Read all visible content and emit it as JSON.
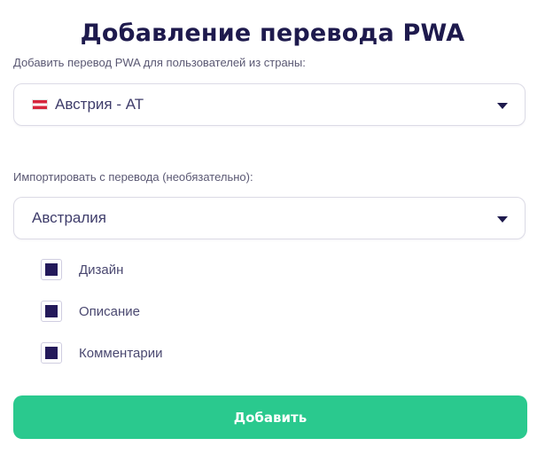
{
  "title": "Добавление перевода PWA",
  "country_field": {
    "label": "Добавить перевод PWA для пользователей из страны:",
    "selected": "Австрия - AT",
    "flag_icon": "flag-austria-icon"
  },
  "import_field": {
    "label": "Импортировать с перевода (необязательно):",
    "selected": "Австралия"
  },
  "options": [
    {
      "label": "Дизайн",
      "checked": true
    },
    {
      "label": "Описание",
      "checked": true
    },
    {
      "label": "Комментарии",
      "checked": true
    }
  ],
  "submit_label": "Добавить",
  "colors": {
    "title": "#1e1a4d",
    "checkbox_fill": "#23195a",
    "button": "#2ac98e",
    "flag_red": "#d7263d"
  }
}
